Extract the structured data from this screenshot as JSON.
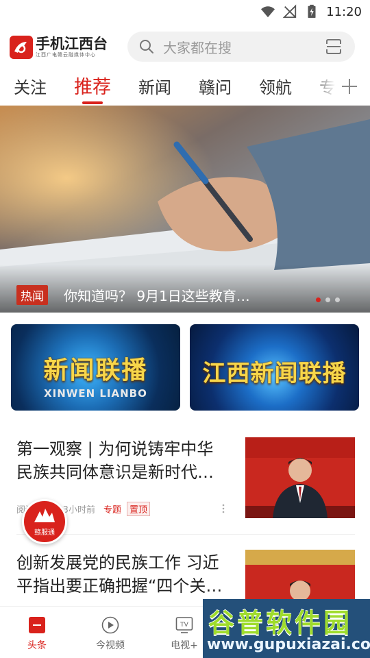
{
  "status_bar": {
    "time": "11:20"
  },
  "header": {
    "logo_title": "手机江西台",
    "logo_subtitle": "江西广电赣云融媒体中心",
    "search_placeholder": "大家都在搜"
  },
  "tabs": [
    {
      "label": "关注",
      "active": false
    },
    {
      "label": "推荐",
      "active": true
    },
    {
      "label": "新闻",
      "active": false
    },
    {
      "label": "赣问",
      "active": false
    },
    {
      "label": "领航",
      "active": false
    },
    {
      "label": "专",
      "active": false
    }
  ],
  "banner": {
    "tag": "热闻",
    "title": "你知道吗？ 9月1日这些教育…",
    "page_count": 3,
    "active_page": 1
  },
  "program_cards": [
    {
      "title": "新闻联播",
      "subtitle": "XINWEN LIANBO"
    },
    {
      "title": "江西新闻联播"
    }
  ],
  "news": [
    {
      "title": "第一观察 | 为何说铸牢中华民族共同体意识是新时代…",
      "views": "阅读 2万",
      "time": "13小时前",
      "special": "专题",
      "pin": "置顶"
    },
    {
      "title": "创新发展党的民族工作 习近平指出要正确把握“四个关…"
    }
  ],
  "float_button": {
    "label": "赣服通"
  },
  "bottom_nav": [
    {
      "label": "头条",
      "active": true
    },
    {
      "label": "今视频",
      "active": false
    },
    {
      "label": "电视+",
      "active": false
    }
  ],
  "watermark": {
    "main": "谷普软件园",
    "url": "www.gupuxiazai.com"
  },
  "colors": {
    "accent": "#d9221c"
  }
}
